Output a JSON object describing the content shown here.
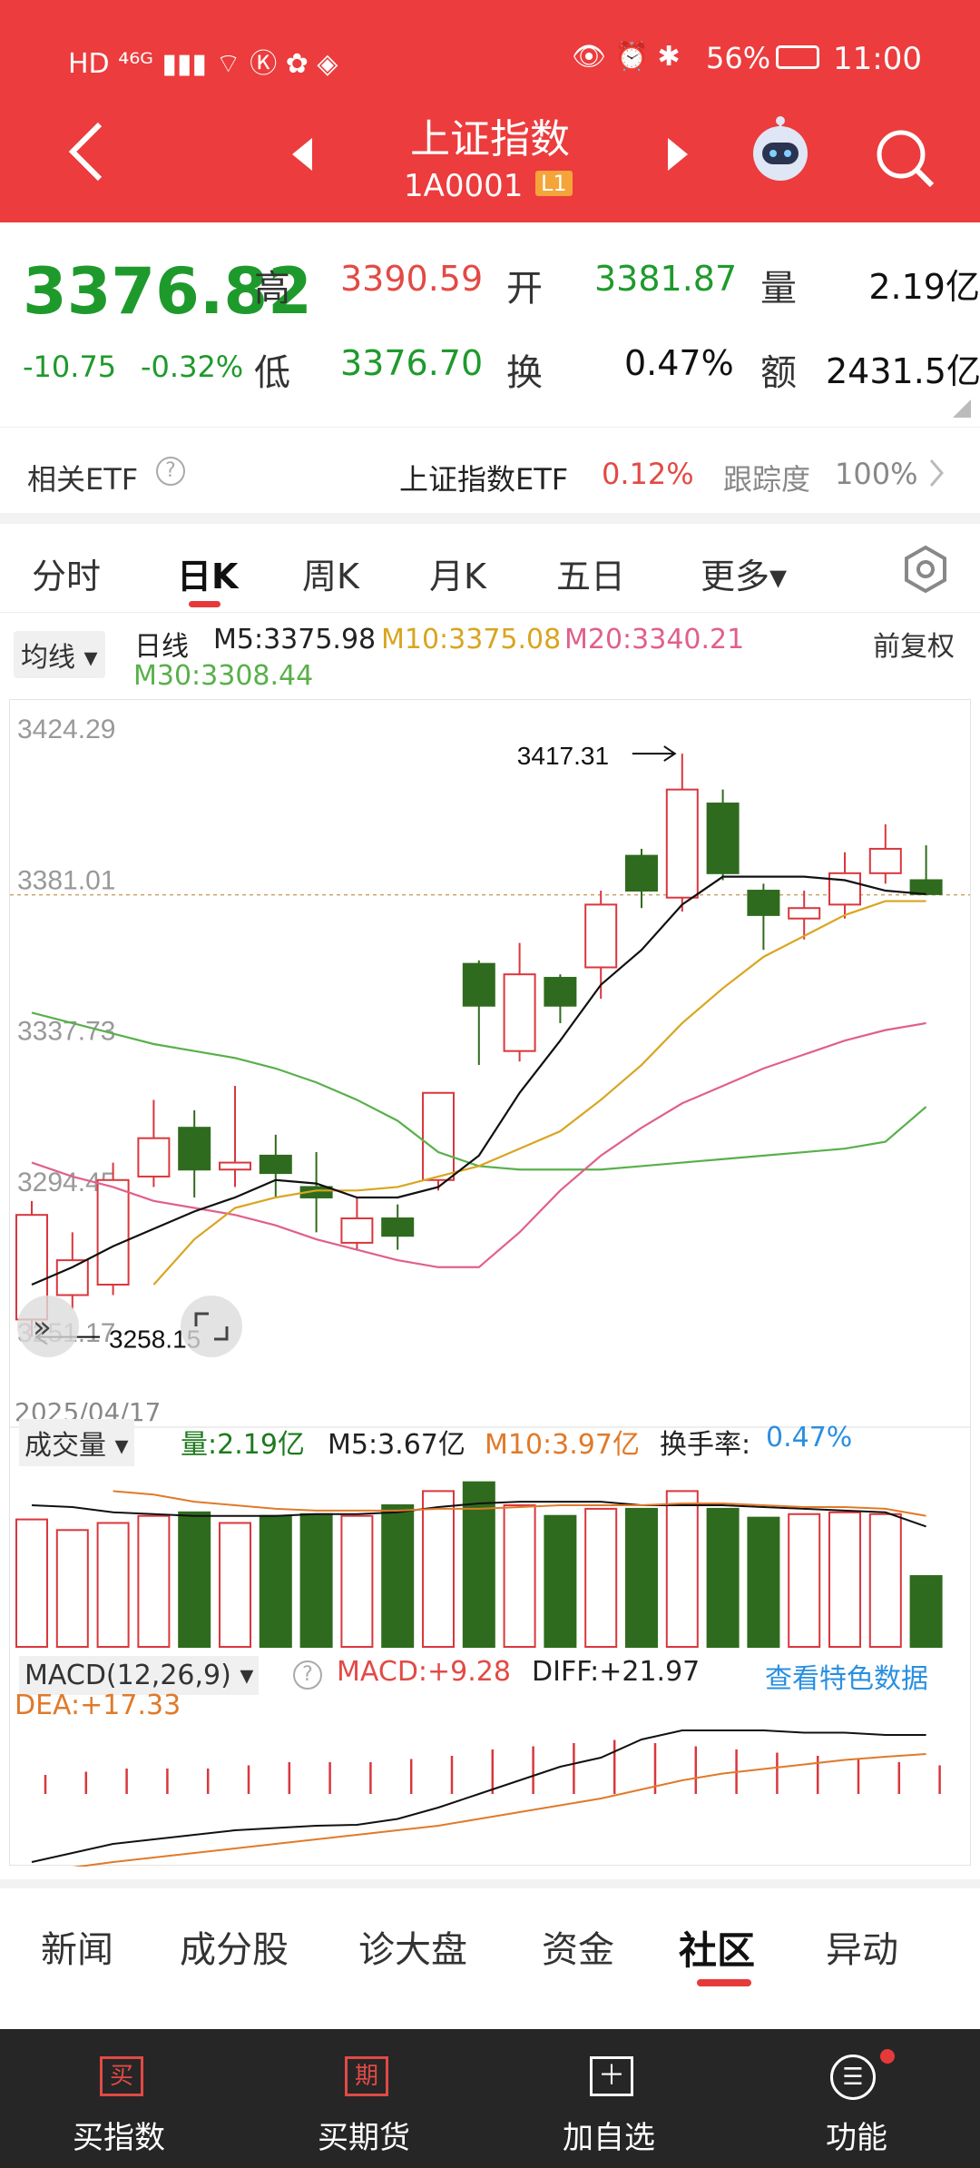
{
  "status": {
    "left": "HD ⁴⁶ᴳ ▮▮▮ ⌔ Ⓚ ✿ ◈",
    "battery": "56%",
    "time": "11:00"
  },
  "nav": {
    "title": "上证指数",
    "code": "1A0001",
    "badge": "L1"
  },
  "quote": {
    "price": "3376.82",
    "change": "-10.75",
    "pct": "-0.32%",
    "high_label": "高",
    "high": "3390.59",
    "open_label": "开",
    "open": "3381.87",
    "vol_label": "量",
    "vol": "2.19亿",
    "low_label": "低",
    "low": "3376.70",
    "turn_label": "换",
    "turn": "0.47%",
    "amt_label": "额",
    "amt": "2431.5亿"
  },
  "etf": {
    "label": "相关ETF",
    "name": "上证指数ETF",
    "pct": "0.12%",
    "track_label": "跟踪度",
    "track": "100%"
  },
  "tabs": [
    {
      "label": "分时"
    },
    {
      "label": "日K"
    },
    {
      "label": "周K"
    },
    {
      "label": "月K"
    },
    {
      "label": "五日"
    },
    {
      "label": "更多▾"
    }
  ],
  "ma": {
    "select": "均线 ▾",
    "type": "日线",
    "m5": "M5:3375.98",
    "m10": "M10:3375.08",
    "m20": "M20:3340.21",
    "m30": "M30:3308.44",
    "adj": "前复权"
  },
  "chart_data": {
    "type": "candlestick",
    "yticks": [
      "3424.29",
      "3381.01",
      "3337.73",
      "3294.45",
      "3251.17"
    ],
    "ylim": [
      3240,
      3428
    ],
    "max_label": "3417.31",
    "min_label": "3258.15",
    "date": "2025/04/17",
    "last_price": 3376.8,
    "candles": [
      {
        "o": 3255,
        "c": 3285,
        "h": 3289,
        "l": 3250
      },
      {
        "o": 3262,
        "c": 3272,
        "h": 3280,
        "l": 3258
      },
      {
        "o": 3265,
        "c": 3295,
        "h": 3300,
        "l": 3262
      },
      {
        "o": 3296,
        "c": 3307,
        "h": 3318,
        "l": 3293
      },
      {
        "o": 3310,
        "c": 3298,
        "h": 3315,
        "l": 3290
      },
      {
        "o": 3298,
        "c": 3300,
        "h": 3322,
        "l": 3293
      },
      {
        "o": 3302,
        "c": 3297,
        "h": 3308,
        "l": 3290
      },
      {
        "o": 3293,
        "c": 3290,
        "h": 3303,
        "l": 3280
      },
      {
        "o": 3277,
        "c": 3284,
        "h": 3290,
        "l": 3275
      },
      {
        "o": 3284,
        "c": 3279,
        "h": 3288,
        "l": 3275
      },
      {
        "o": 3295,
        "c": 3320,
        "h": 3320,
        "l": 3292
      },
      {
        "o": 3357,
        "c": 3345,
        "h": 3358,
        "l": 3328
      },
      {
        "o": 3332,
        "c": 3354,
        "h": 3363,
        "l": 3329
      },
      {
        "o": 3353,
        "c": 3345,
        "h": 3354,
        "l": 3340
      },
      {
        "o": 3356,
        "c": 3374,
        "h": 3378,
        "l": 3347
      },
      {
        "o": 3388,
        "c": 3378,
        "h": 3390,
        "l": 3373
      },
      {
        "o": 3376,
        "c": 3407,
        "h": 3417.3,
        "l": 3372
      },
      {
        "o": 3403,
        "c": 3383,
        "h": 3407,
        "l": 3381
      },
      {
        "o": 3378,
        "c": 3371,
        "h": 3380,
        "l": 3361
      },
      {
        "o": 3370,
        "c": 3373,
        "h": 3378,
        "l": 3364
      },
      {
        "o": 3374,
        "c": 3383,
        "h": 3389,
        "l": 3370
      },
      {
        "o": 3383,
        "c": 3390,
        "h": 3397,
        "l": 3380
      },
      {
        "o": 3381,
        "c": 3377,
        "h": 3391,
        "l": 3377
      }
    ],
    "ma5": [
      3265,
      3270,
      3276,
      3281,
      3286,
      3290,
      3295,
      3294,
      3290,
      3290,
      3293,
      3302,
      3320,
      3335,
      3351,
      3361,
      3374,
      3382,
      3382,
      3382,
      3381,
      3378,
      3377
    ],
    "ma10": [
      null,
      null,
      null,
      3265,
      3278,
      3287,
      3290,
      3292,
      3292,
      3293,
      3296,
      3299,
      3304,
      3309,
      3318,
      3328,
      3340,
      3350,
      3359,
      3365,
      3371,
      3375,
      3375
    ],
    "ma20": [
      3300,
      3296,
      3293,
      3289,
      3287,
      3285,
      3282,
      3278,
      3275,
      3272,
      3270,
      3270,
      3280,
      3292,
      3302,
      3310,
      3317,
      3322,
      3327,
      3331,
      3335,
      3338,
      3340
    ],
    "ma30": [
      3343,
      3340,
      3337,
      3334,
      3332,
      3330,
      3327,
      3323,
      3318,
      3312,
      3303,
      3299,
      3298,
      3298,
      3298,
      3299,
      3300,
      3301,
      3302,
      3303,
      3304,
      3306,
      3316
    ]
  },
  "vol": {
    "select": "成交量 ▾",
    "vol": "量:2.19亿",
    "m5": "M5:3.67亿",
    "m10": "M10:3.97亿",
    "turn_label": "换手率:",
    "turn": "0.47%"
  },
  "macd": {
    "select": "MACD(12,26,9) ▾",
    "macd": "MACD:+9.28",
    "diff": "DIFF:+21.97",
    "dea": "DEA:+17.33",
    "link": "查看特色数据"
  },
  "bottabs": [
    {
      "label": "新闻"
    },
    {
      "label": "成分股"
    },
    {
      "label": "诊大盘"
    },
    {
      "label": "资金"
    },
    {
      "label": "社区"
    },
    {
      "label": "异动"
    }
  ],
  "bottombar": [
    {
      "icon": "买",
      "label": "买指数"
    },
    {
      "icon": "期",
      "label": "买期货"
    },
    {
      "icon": "＋",
      "label": "加自选"
    },
    {
      "icon": "☰",
      "label": "功能"
    }
  ]
}
